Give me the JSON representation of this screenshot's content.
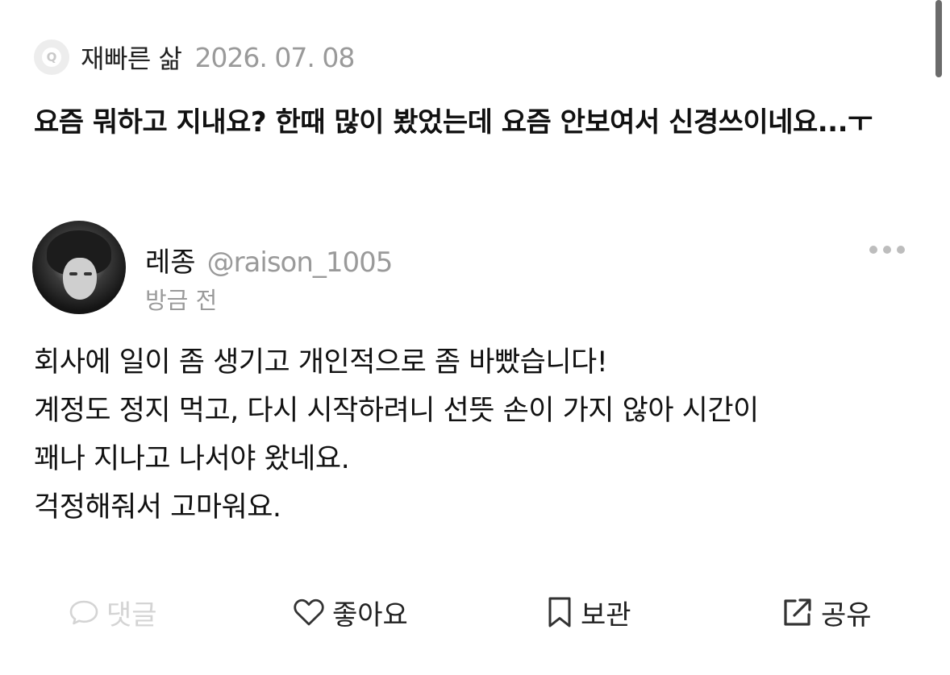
{
  "question": {
    "badge_letter": "Q",
    "author": "재빠른 삶",
    "date": "2026. 07. 08",
    "text": "요즘 뭐하고 지내요? 한때 많이 봤었는데 요즘 안보여서 신경쓰이네요...ㅜ"
  },
  "answer": {
    "name": "레종",
    "handle": "@raison_1005",
    "time": "방금 전",
    "lines": [
      "회사에 일이 좀 생기고 개인적으로 좀 바빴습니다!",
      "계정도 정지 먹고, 다시 시작하려니 선뜻 손이 가지 않아 시간이",
      "꽤나 지나고 나서야 왔네요.",
      "걱정해줘서 고마워요."
    ]
  },
  "actions": {
    "comment": {
      "label": "댓글",
      "icon": "speech-bubble-icon",
      "enabled": false
    },
    "like": {
      "label": "좋아요",
      "icon": "heart-icon"
    },
    "save": {
      "label": "보관",
      "icon": "bookmark-icon"
    },
    "share": {
      "label": "공유",
      "icon": "share-icon"
    }
  },
  "colors": {
    "text": "#111111",
    "muted": "#9a9a9a",
    "disabled": "#d4d4d4",
    "badge_bg": "#ededed"
  }
}
